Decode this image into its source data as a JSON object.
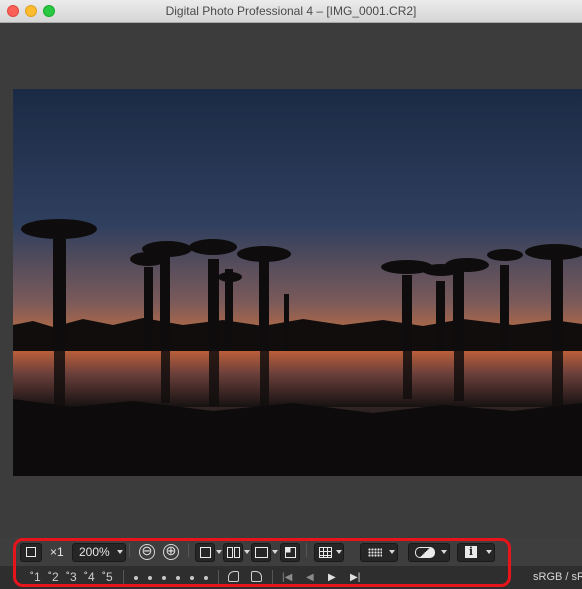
{
  "window": {
    "title": "Digital Photo Professional 4 – [IMG_0001.CR2]"
  },
  "photo": {
    "description_icon": "image-preview",
    "colors": {
      "sky_top": "#1b2a44",
      "horizon": "#e8782e",
      "silhouette": "#0e0c0c",
      "water_glow": "#c9643a"
    }
  },
  "toolbar": {
    "zoom_mult": "×1",
    "zoom_value": "200%",
    "zoom_out_symbol": "⊖",
    "zoom_in_symbol": "⊕",
    "info_symbol": "i"
  },
  "toolbar2": {
    "ratings": [
      "˚1",
      "˚2",
      "˚3",
      "˚4",
      "˚5"
    ],
    "nav": [
      "|◀",
      "◀",
      "▶",
      "▶|"
    ],
    "color_space": "sRGB / sRGB"
  },
  "highlight": {
    "color": "#e8141c"
  }
}
